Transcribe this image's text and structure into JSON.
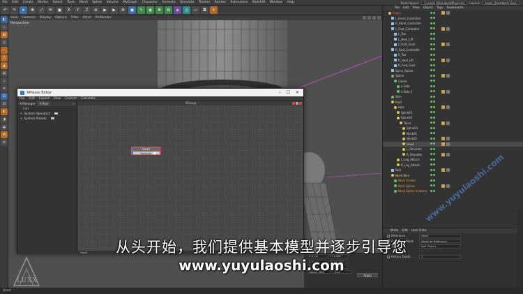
{
  "menubar": {
    "items": [
      "File",
      "Edit",
      "Create",
      "Modes",
      "Select",
      "Tools",
      "Mesh",
      "Spline",
      "Volume",
      "MoGraph",
      "Character",
      "Animate",
      "Simulate",
      "Tracker",
      "Render",
      "Extensions",
      "Redshift",
      "Window",
      "Help"
    ],
    "node_space_label": "Node Space:",
    "node_space_value": "Current (Standard/Physical)",
    "layout_label": "Layout:",
    "layout_value": "team_Standard (User)"
  },
  "viewport": {
    "menu": [
      "View",
      "Cameras",
      "Display",
      "Options",
      "Filter",
      "Panel",
      "ProRender"
    ],
    "label": "Perspective"
  },
  "xpresso": {
    "title": "XPresso Editor",
    "menu": [
      "File",
      "Edit",
      "Layout",
      "View",
      "Custom",
      "Calculate"
    ],
    "tabs": [
      "X-Manager",
      "X-Pool"
    ],
    "sub_label": "Edit",
    "tree": [
      "System Operators",
      "System Presets"
    ],
    "graph_title": "XGroup",
    "node": {
      "title": "Head",
      "label": "Rotation"
    },
    "status": "Head"
  },
  "objmgr": {
    "menu": [
      "File",
      "Edit",
      "View",
      "Object",
      "Tags",
      "Bookmarks"
    ],
    "rows": [
      {
        "name": "Pegas",
        "indent": 4,
        "style": "hl-red",
        "icon": "y"
      },
      {
        "name": "L_Hand_Controller",
        "indent": 8,
        "icon": "sq"
      },
      {
        "name": "R_Hand_Controller",
        "indent": 8,
        "icon": "sq"
      },
      {
        "name": "L_Foot_Controller",
        "indent": 8,
        "icon": "sq"
      },
      {
        "name": "L_Toe",
        "indent": 12,
        "icon": "sq"
      },
      {
        "name": "L_Heel_Lift",
        "indent": 12,
        "icon": "sq"
      },
      {
        "name": "L_Foot_Goal",
        "indent": 12,
        "icon": "sq"
      },
      {
        "name": "R_Foot_Controller",
        "indent": 8,
        "icon": "sq"
      },
      {
        "name": "R_Toe",
        "indent": 12,
        "icon": "sq"
      },
      {
        "name": "R_Heel_Lift",
        "indent": 12,
        "icon": "sq"
      },
      {
        "name": "R_Foot_Goal",
        "indent": 12,
        "icon": "sq"
      },
      {
        "name": "Spine_Spline",
        "indent": 8,
        "icon": "sq"
      },
      {
        "name": "Spline",
        "indent": 8,
        "icon": "g"
      },
      {
        "name": "Cloner",
        "indent": 12,
        "icon": "g"
      },
      {
        "name": "n-Side",
        "indent": 16,
        "icon": "g"
      },
      {
        "name": "n-Side.1",
        "indent": 16,
        "icon": "g"
      },
      {
        "name": "Skin",
        "indent": 8,
        "icon": "g"
      },
      {
        "name": "Root",
        "indent": 8,
        "icon": "y"
      },
      {
        "name": "Hips",
        "indent": 12,
        "icon": "y"
      },
      {
        "name": "Spine01",
        "indent": 16,
        "icon": "y"
      },
      {
        "name": "Spine02",
        "indent": 16,
        "icon": "y"
      },
      {
        "name": "Torso",
        "indent": 20,
        "icon": "y"
      },
      {
        "name": "Spine01",
        "indent": 24,
        "icon": "y"
      },
      {
        "name": "Neck01",
        "indent": 24,
        "icon": "y"
      },
      {
        "name": "Neck02",
        "indent": 24,
        "icon": "y"
      },
      {
        "name": "Head",
        "indent": 24,
        "icon": "y"
      },
      {
        "name": "L_Shoulder",
        "indent": 24,
        "icon": "y"
      },
      {
        "name": "R_Shoulder",
        "indent": 24,
        "icon": "y"
      },
      {
        "name": "L_Leg_Attach",
        "indent": 16,
        "icon": "y"
      },
      {
        "name": "R_Leg_Attach",
        "indent": 16,
        "icon": "y"
      },
      {
        "name": "Null",
        "indent": 8,
        "icon": "sq"
      },
      {
        "name": "Neck Wire",
        "indent": 8,
        "style": "hl-yellow",
        "icon": "y"
      },
      {
        "name": "Neck Circles",
        "indent": 12,
        "style": "hl-orange",
        "icon": "g"
      },
      {
        "name": "Neck Spline",
        "indent": 12,
        "style": "hl-orange",
        "icon": "g"
      },
      {
        "name": "Neck Spline Instance",
        "indent": 12,
        "style": "hl-orange",
        "icon": "g"
      }
    ]
  },
  "attr": {
    "menu": [
      "Mode",
      "Edit",
      "User Data"
    ],
    "rows": [
      {
        "label": "Reference",
        "value": "Head"
      },
      {
        "label": "Reference Mode",
        "value": "Absolute Reference"
      },
      {
        "label": "Type",
        "value": "Null Object"
      },
      {
        "label": "",
        "value": ""
      },
      {
        "label": "History Depth",
        "value": "1"
      }
    ]
  },
  "coords": {
    "rows": [
      {
        "a": "X 0 cm",
        "b": "H 1.082 °"
      },
      {
        "a": "Y 0 cm",
        "b": "P -9.135 °"
      },
      {
        "a": "Z 0 cm",
        "b": "B 1.208 °"
      }
    ],
    "mode": "Object (Rel)",
    "size": "Size",
    "apply": "Apply"
  },
  "status": {
    "text": "Head"
  },
  "subtitles": {
    "line1": "从头开始，我们提供基本模型并逐步引导您",
    "line2": "www.yuyulaoshi.com"
  },
  "watermark": {
    "text": "www.yuyulaoshi.com",
    "logo": "LUXX"
  },
  "colors": {
    "accent": "#3d74c0",
    "node_border": "#d85a5a",
    "pink_line": "#d64cd6"
  }
}
